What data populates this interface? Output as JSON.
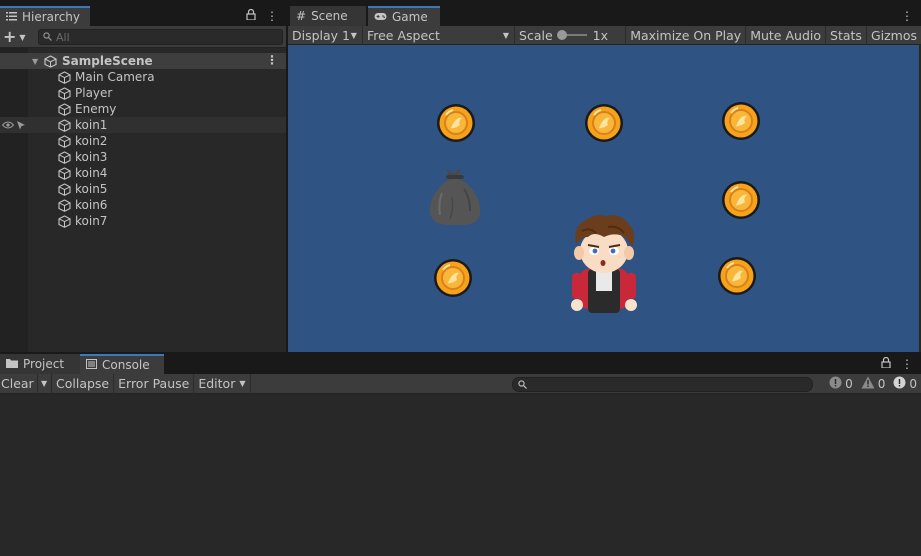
{
  "hierarchy": {
    "tab_label": "Hierarchy",
    "search_placeholder": "All",
    "scene_name": "SampleScene",
    "items": [
      {
        "label": "Main Camera"
      },
      {
        "label": "Player"
      },
      {
        "label": "Enemy"
      },
      {
        "label": "koin1"
      },
      {
        "label": "koin2"
      },
      {
        "label": "koin3"
      },
      {
        "label": "koin4"
      },
      {
        "label": "koin5"
      },
      {
        "label": "koin6"
      },
      {
        "label": "koin7"
      }
    ]
  },
  "game": {
    "tabs": [
      {
        "label": "Scene"
      },
      {
        "label": "Game"
      }
    ],
    "toolbar": {
      "display": "Display 1",
      "aspect": "Free Aspect",
      "scale_label": "Scale",
      "scale_value": "1x",
      "maximize": "Maximize On Play",
      "mute": "Mute Audio",
      "stats": "Stats",
      "gizmos": "Gizmos"
    },
    "colors": {
      "background": "#2f5383",
      "coin": "#f7a21b"
    }
  },
  "console": {
    "tabs": [
      {
        "label": "Project"
      },
      {
        "label": "Console"
      }
    ],
    "toolbar": {
      "clear": "Clear",
      "collapse": "Collapse",
      "error_pause": "Error Pause",
      "editor": "Editor"
    },
    "counts": {
      "info": "0",
      "warning": "0",
      "error": "0"
    }
  }
}
